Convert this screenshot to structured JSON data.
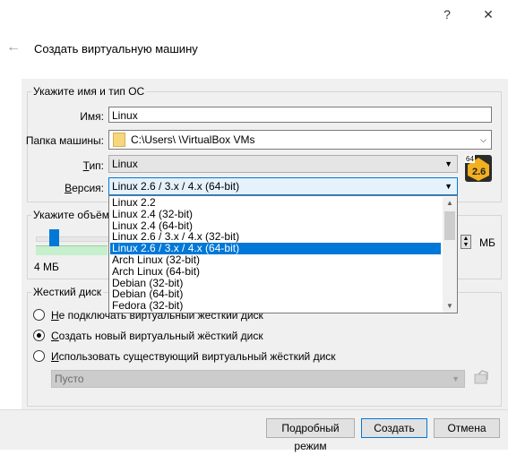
{
  "window": {
    "help_label": "?",
    "close_label": "✕"
  },
  "wizard": {
    "back_glyph": "←",
    "title": "Создать виртуальную машину"
  },
  "name_os": {
    "group_title": "Укажите имя и тип ОС",
    "name_label": "Имя:",
    "name_value": "Linux",
    "folder_label": "Папка машины:",
    "folder_value": "C:\\Users\\      \\VirtualBox VMs",
    "type_label_pre": "",
    "type_label_u": "Т",
    "type_label_post": "ип:",
    "type_value": "Linux",
    "version_label_pre": "",
    "version_label_u": "В",
    "version_label_post": "ерсия:",
    "version_value": "Linux 2.6 / 3.x / 4.x (64-bit)",
    "os_badge_top": "64",
    "os_badge_main": "2.6"
  },
  "version_dropdown": {
    "items": [
      "Linux 2.2",
      "Linux 2.4 (32-bit)",
      "Linux 2.4 (64-bit)",
      "Linux 2.6 / 3.x / 4.x (32-bit)",
      "Linux 2.6 / 3.x / 4.x (64-bit)",
      "Arch Linux (32-bit)",
      "Arch Linux (64-bit)",
      "Debian (32-bit)",
      "Debian (64-bit)",
      "Fedora (32-bit)"
    ],
    "selected_index": 4
  },
  "memory": {
    "group_title": "Укажите объём п",
    "min_label": "4 МБ",
    "unit_label": "МБ"
  },
  "disk": {
    "group_title": "Жесткий диск",
    "option1_u": "Н",
    "option1_rest": "е подключать виртуальный жёсткий диск",
    "option2_u": "С",
    "option2_rest": "оздать новый виртуальный жёсткий диск",
    "option3_u": "И",
    "option3_rest": "спользовать существующий виртуальный жёсткий диск",
    "existing_value": "Пусто",
    "selected": 2
  },
  "buttons": {
    "expert": "Подробный режим",
    "create": "Создать",
    "cancel": "Отмена"
  }
}
